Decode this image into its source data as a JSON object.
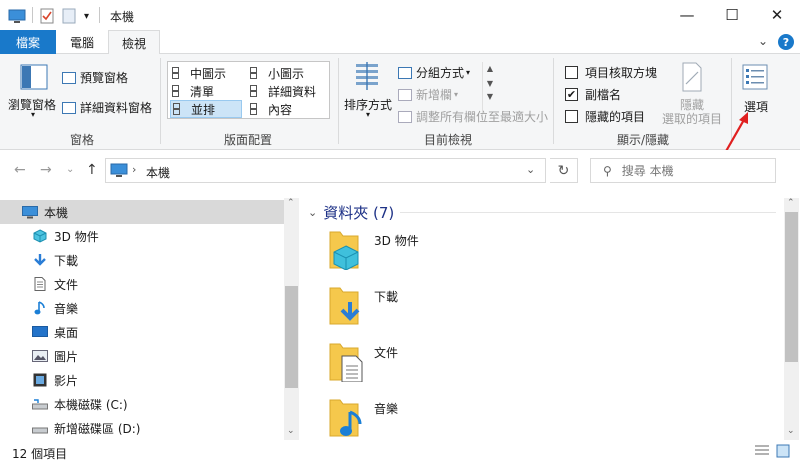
{
  "window": {
    "title": "本機",
    "minimize": "—",
    "maximize": "☐",
    "close": "✕"
  },
  "tabs": {
    "file": "檔案",
    "computer": "電腦",
    "view": "檢視"
  },
  "ribbon": {
    "panes": {
      "nav_pane": "瀏覽窗格",
      "preview_pane": "預覽窗格",
      "details_pane": "詳細資料窗格",
      "label": "窗格"
    },
    "layout": {
      "medium_icons": "中圖示",
      "small_icons": "小圖示",
      "list": "清單",
      "details": "詳細資料",
      "tiles": "並排",
      "content": "內容",
      "label": "版面配置"
    },
    "current_view": {
      "sort_by": "排序方式",
      "group_by": "分組方式",
      "add_columns": "新增欄",
      "size_all_columns": "調整所有欄位至最適大小",
      "label": "目前檢視"
    },
    "show_hide": {
      "item_checkboxes": "項目核取方塊",
      "file_extensions": "副檔名",
      "hidden_items": "隱藏的項目",
      "hide_selected_line1": "隱藏",
      "hide_selected_line2": "選取的項目",
      "label": "顯示/隱藏"
    },
    "options": "選項"
  },
  "address": {
    "path": "本機",
    "search_placeholder": "搜尋 本機"
  },
  "nav_pane": {
    "items": [
      {
        "label": "本機",
        "icon": "monitor-icon"
      },
      {
        "label": "3D 物件",
        "icon": "cube-icon"
      },
      {
        "label": "下載",
        "icon": "download-icon"
      },
      {
        "label": "文件",
        "icon": "document-icon"
      },
      {
        "label": "音樂",
        "icon": "music-icon"
      },
      {
        "label": "桌面",
        "icon": "desktop-icon"
      },
      {
        "label": "圖片",
        "icon": "pictures-icon"
      },
      {
        "label": "影片",
        "icon": "video-icon"
      },
      {
        "label": "本機磁碟 (C:)",
        "icon": "drive-icon"
      },
      {
        "label": "新增磁碟區 (D:)",
        "icon": "drive-icon"
      }
    ]
  },
  "content": {
    "folders_header": "資料夾 (7)",
    "files": [
      {
        "label": "3D 物件",
        "icon": "cube-folder-icon"
      },
      {
        "label": "下載",
        "icon": "download-folder-icon"
      },
      {
        "label": "文件",
        "icon": "document-folder-icon"
      },
      {
        "label": "音樂",
        "icon": "music-folder-icon"
      }
    ]
  },
  "status": {
    "count": "12 個項目"
  },
  "colors": {
    "accent": "#1979ca",
    "selection": "#cce4f7",
    "folder": "#f5c84c",
    "arrow": "#e02020"
  }
}
